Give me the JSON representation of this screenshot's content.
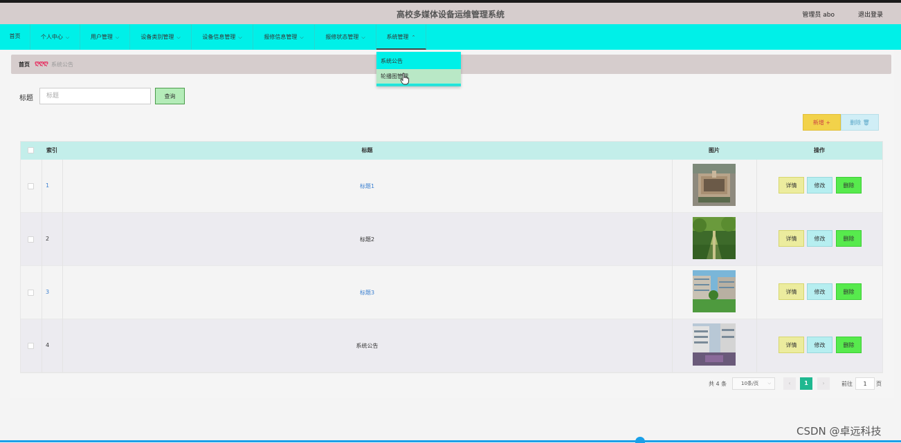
{
  "header": {
    "title": "高校多媒体设备运维管理系统",
    "admin_label": "管理员 abo",
    "logout_label": "退出登录"
  },
  "nav": {
    "items": [
      {
        "label": "首页"
      },
      {
        "label": "个人中心"
      },
      {
        "label": "用户管理"
      },
      {
        "label": "设备类别管理"
      },
      {
        "label": "设备信息管理"
      },
      {
        "label": "报修信息管理"
      },
      {
        "label": "报修状态管理"
      },
      {
        "label": "系统管理"
      }
    ],
    "active": "系统管理",
    "dropdown": [
      {
        "label": "系统公告"
      },
      {
        "label": "轮播图管理"
      }
    ]
  },
  "breadcrumb": {
    "home": "首页",
    "separator": "ღღღ",
    "current": "系统公告"
  },
  "search": {
    "label": "标题",
    "placeholder": "标题",
    "value": "",
    "button": "查询"
  },
  "actions": {
    "add": "新增 +",
    "delete": "删除 🗑"
  },
  "table": {
    "columns": [
      "索引",
      "标题",
      "图片",
      "操作"
    ],
    "rows": [
      {
        "index": "1",
        "title": "标题1",
        "image": "building-aerial-image",
        "link": true
      },
      {
        "index": "2",
        "title": "标题2",
        "image": "park-garden-image",
        "link": false
      },
      {
        "index": "3",
        "title": "标题3",
        "image": "campus-courtyard-image",
        "link": true
      },
      {
        "index": "4",
        "title": "系统公告",
        "image": "modern-building-image",
        "link": false
      }
    ],
    "row_actions": {
      "detail": "详情",
      "edit": "修改",
      "delete": "删除"
    }
  },
  "pagination": {
    "total": "共 4 条",
    "page_size": "10条/页",
    "current_page": "1",
    "goto_label": "前往",
    "goto_value": "1",
    "page_suffix": "页",
    "prev": "‹",
    "next": "›"
  },
  "watermark": "CSDN @卓远科技",
  "colors": {
    "nav_bg": "#00f0e8",
    "header_bg": "#d6cdcd",
    "table_head": "#c3eeea",
    "pager_active": "#1fb890"
  }
}
